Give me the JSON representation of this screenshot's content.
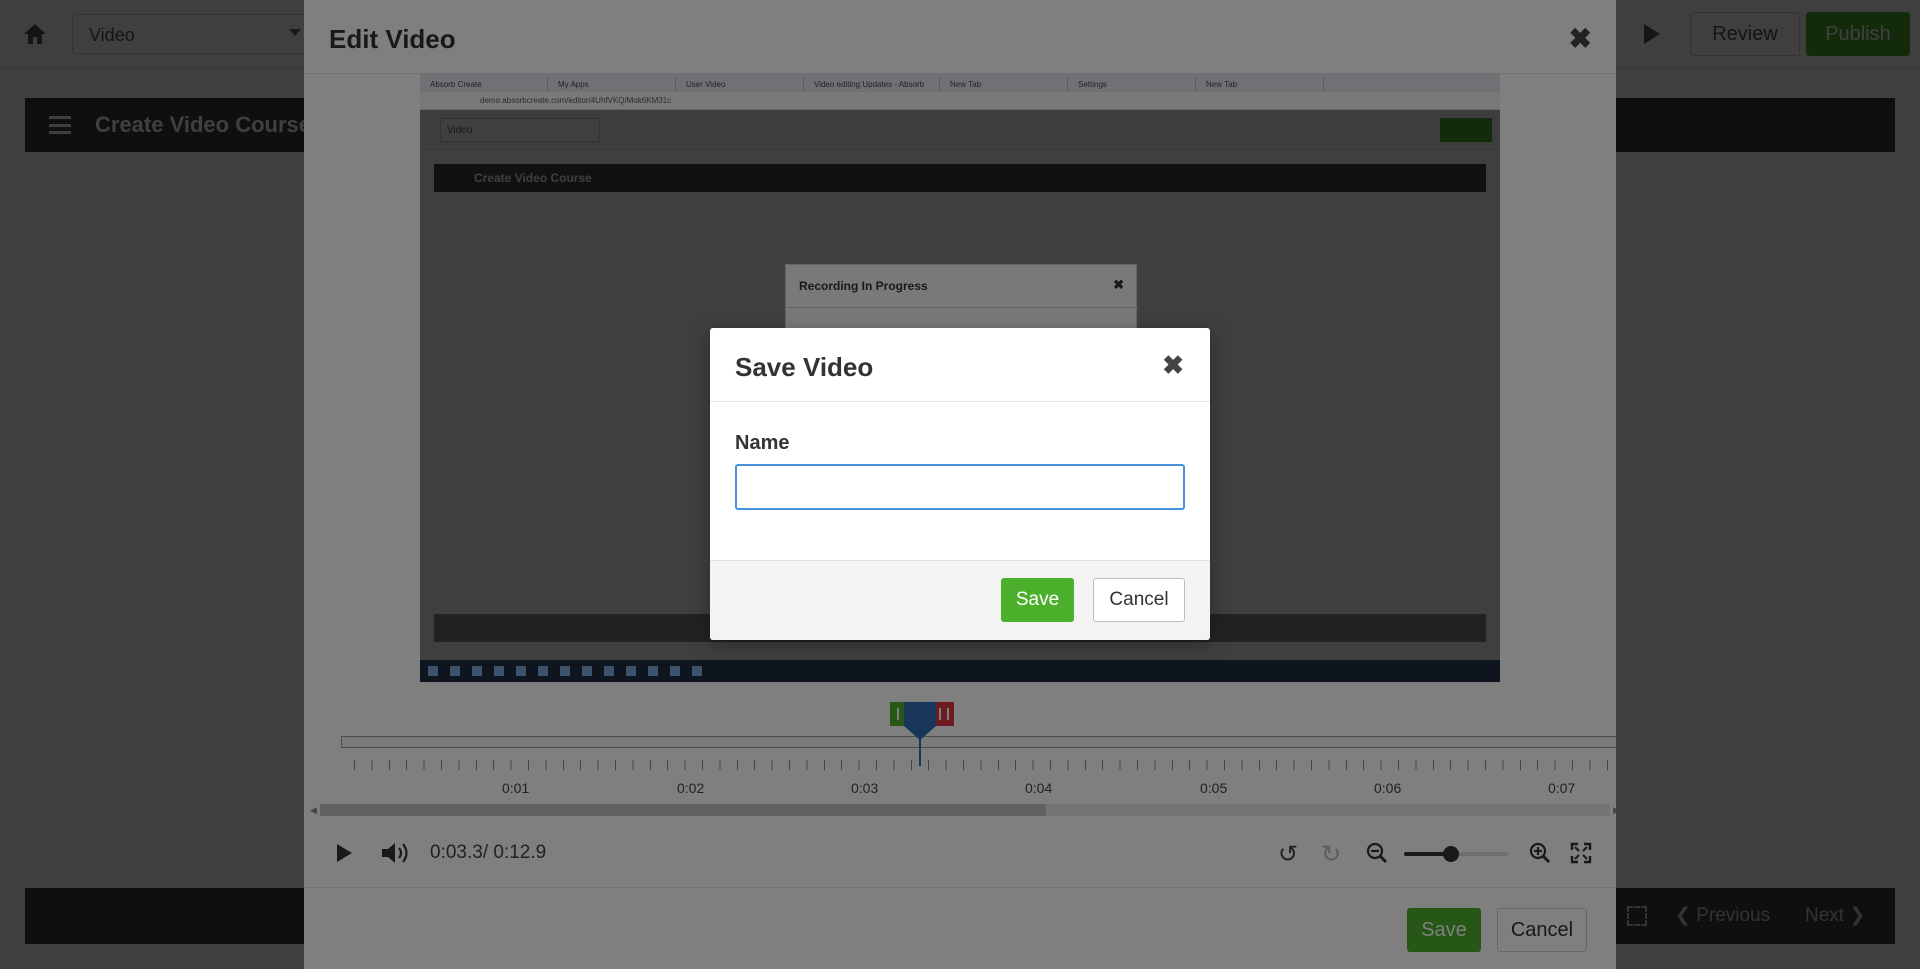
{
  "background": {
    "select_value": "Video",
    "review_label": "Review",
    "publish_label": "Publish",
    "course_title": "Create Video Course",
    "previous_label": "Previous",
    "next_label": "Next"
  },
  "edit_modal": {
    "title": "Edit Video",
    "close_glyph": "✖",
    "preview": {
      "tabs": [
        "Absorb Create",
        "My Apps",
        "User Video",
        "Video editing Updates - Absorb",
        "New Tab",
        "Settings",
        "New Tab"
      ],
      "url": "demo.absorbcreate.com/editor/4UhfVKQ/Mok6KM31c",
      "select_value": "Video",
      "course_title": "Create Video Course",
      "recording_title": "Recording In Progress",
      "recording_close": "✖"
    },
    "timeline": {
      "tick_labels": [
        "0:01",
        "0:02",
        "0:03",
        "0:04",
        "0:05",
        "0:06",
        "0:07"
      ],
      "current_time": "0:03.3/ 0:12.9",
      "zoom_level": 0.45
    },
    "save_label": "Save",
    "cancel_label": "Cancel"
  },
  "save_dialog": {
    "title": "Save Video",
    "close_glyph": "✖",
    "name_label": "Name",
    "name_value": "",
    "name_placeholder": "",
    "save_label": "Save",
    "cancel_label": "Cancel"
  },
  "colors": {
    "accent_green": "#4caf2c",
    "danger_red": "#d9363e",
    "focus_blue": "#4a90d9",
    "playhead_blue": "#2f6db5"
  },
  "icons": [
    "home-icon",
    "hamburger-icon",
    "play-icon",
    "volume-icon",
    "undo-icon",
    "redo-icon",
    "zoom-out-icon",
    "zoom-in-icon",
    "fullscreen-icon",
    "close-icon"
  ]
}
